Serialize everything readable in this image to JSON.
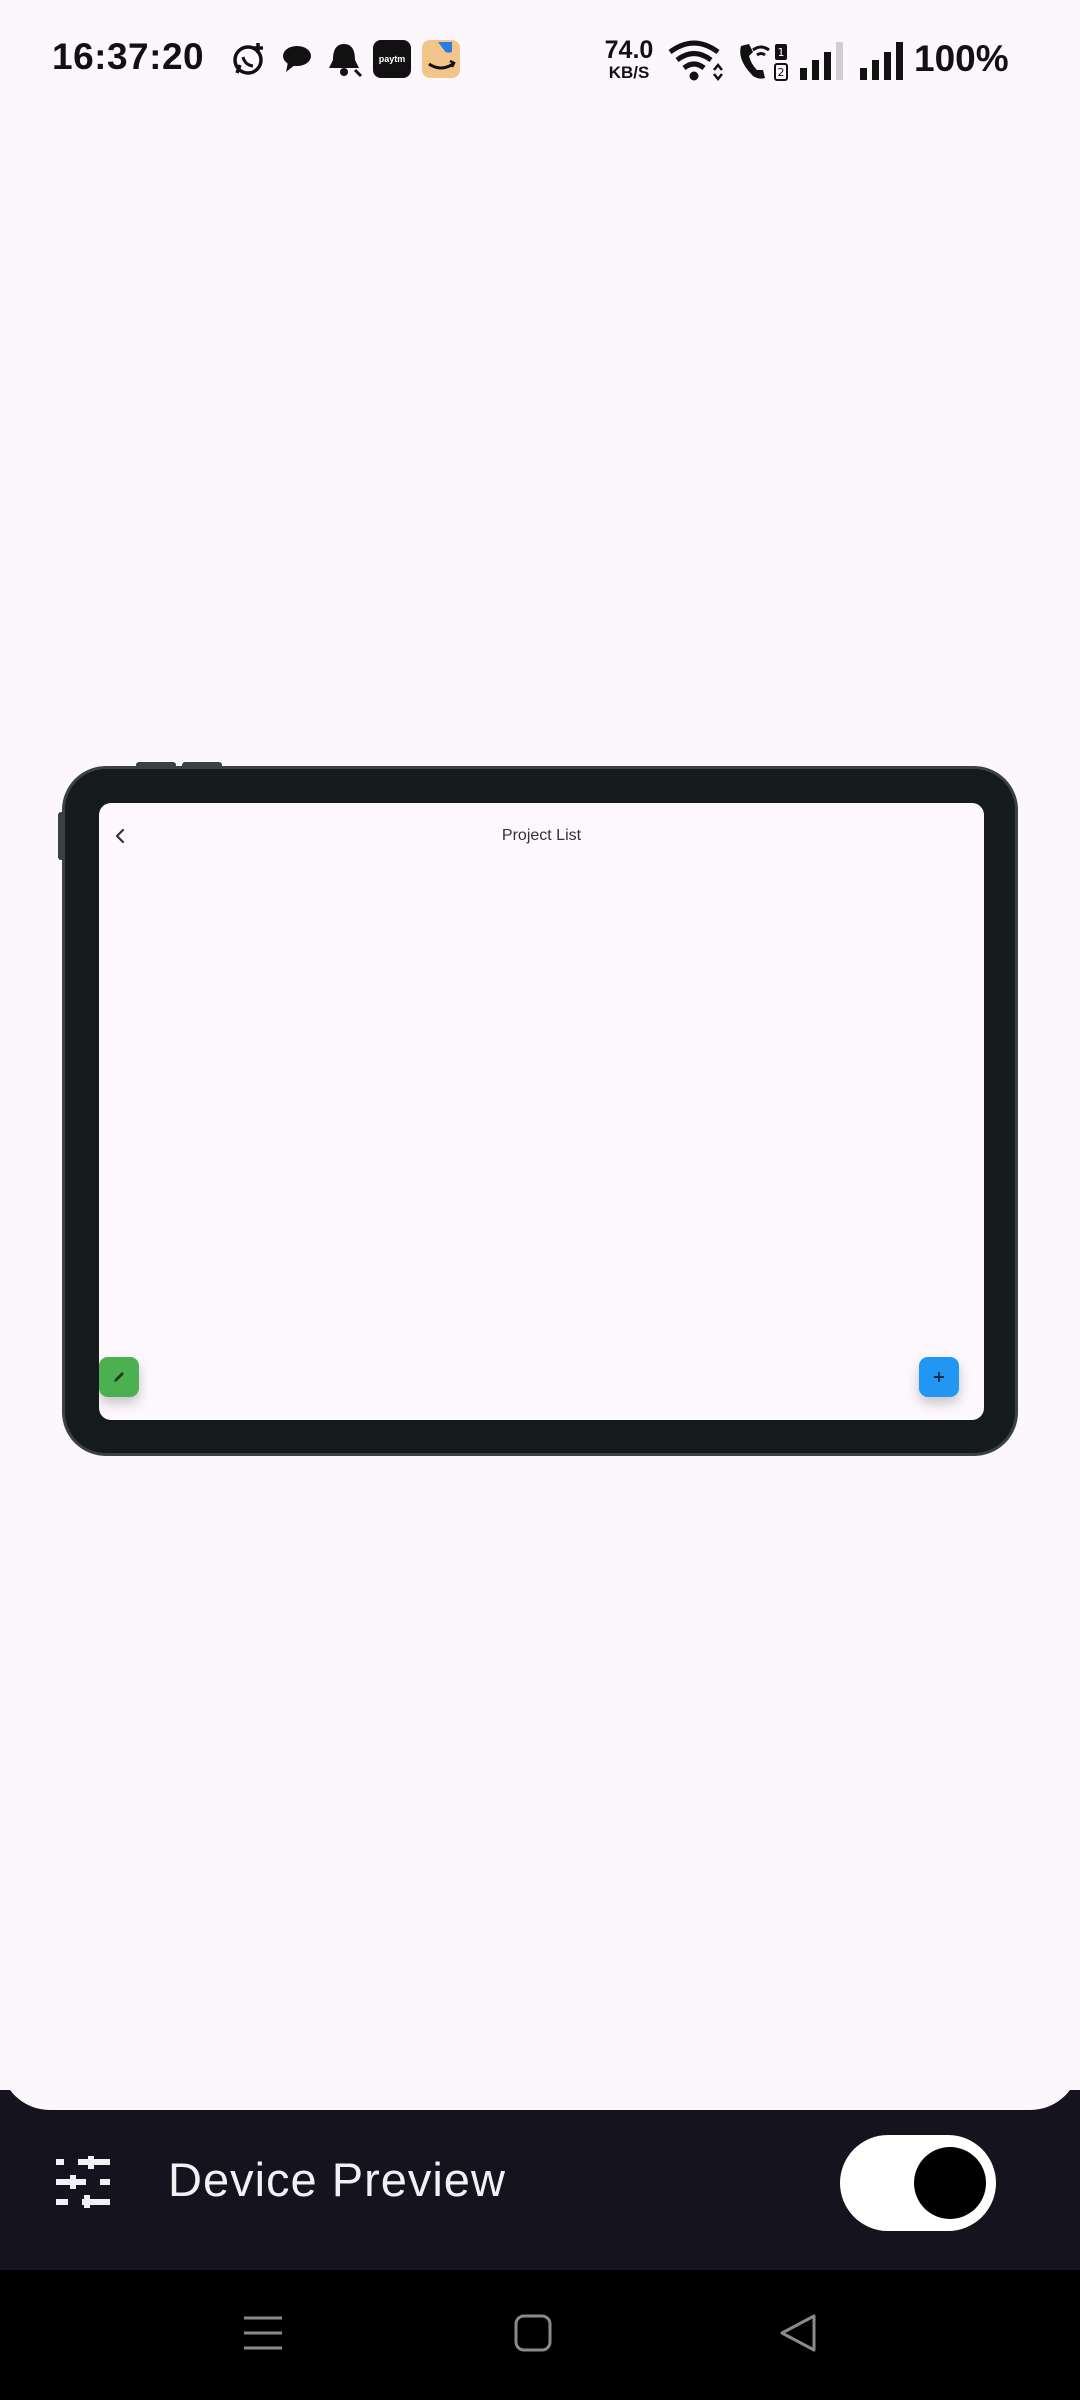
{
  "status_bar": {
    "time": "16:37:20",
    "net_speed_value": "74.0",
    "net_speed_unit": "KB/S",
    "battery": "100%",
    "icons": [
      "whatsapp-icon",
      "chat-icon",
      "bell-icon",
      "paytm-icon",
      "amazon-icon",
      "wifi-icon",
      "wifi-call-icon",
      "signal-icon",
      "signal-icon"
    ],
    "paytm_label": "paytm"
  },
  "preview": {
    "screen_title": "Project List",
    "back_icon": "chevron-left-icon",
    "edit_fab_icon": "edit-icon",
    "add_fab_icon": "plus-icon",
    "colors": {
      "edit_fab": "#4caf50",
      "add_fab": "#2196f3",
      "frame": "#151a1b"
    }
  },
  "toolbar": {
    "title": "Device Preview",
    "settings_icon": "tune-icon",
    "toggle_on": true
  },
  "navbar": {
    "icons": [
      "menu-icon",
      "home-icon",
      "back-icon"
    ]
  }
}
